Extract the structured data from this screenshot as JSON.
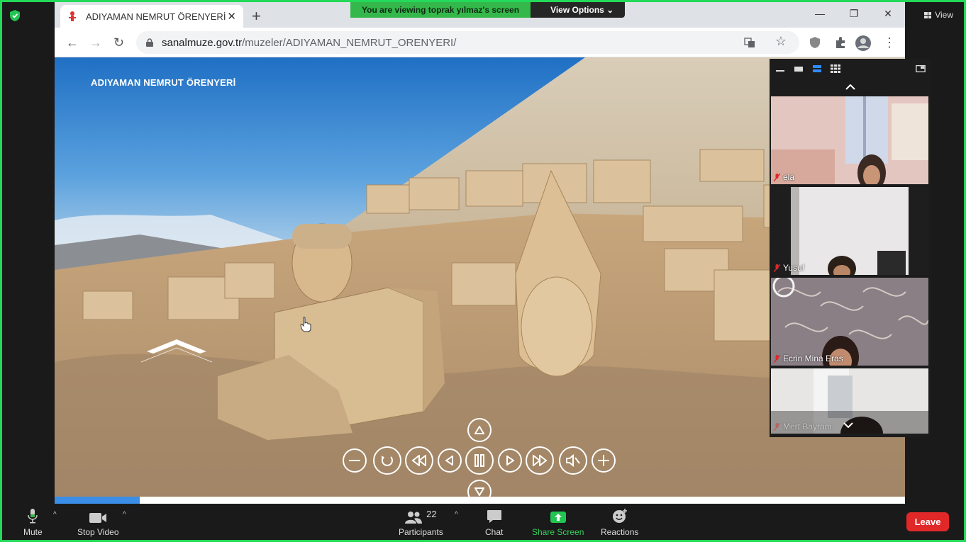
{
  "zoom_top": {
    "share_banner": "You are viewing toprak yılmaz's screen",
    "view_options": "View Options",
    "view_button": "View"
  },
  "browser": {
    "tab_title": "ADIYAMAN NEMRUT ÖRENYERİ",
    "url_host": "sanalmuze.gov.tr",
    "url_path": "/muzeler/ADIYAMAN_NEMRUT_ORENYERI/"
  },
  "page": {
    "site_title": "ADIYAMAN NEMRUT ÖRENYERİ",
    "progress": 0.1
  },
  "gallery": {
    "participants": [
      {
        "name": "ela",
        "muted": true
      },
      {
        "name": "Yusuf",
        "muted": true
      },
      {
        "name": "Ecrin Mina Eras",
        "muted": true
      },
      {
        "name": "Mert Bayram",
        "muted": true
      }
    ]
  },
  "zoom_toolbar": {
    "mute": "Mute",
    "stop_video": "Stop Video",
    "participants": "Participants",
    "participants_count": "22",
    "chat": "Chat",
    "share_screen": "Share Screen",
    "reactions": "Reactions",
    "leave": "Leave"
  },
  "colors": {
    "zoom_green": "#23d959",
    "share_green": "#35b84b",
    "leave_red": "#e02828",
    "progress_blue": "#3a8ee6"
  }
}
